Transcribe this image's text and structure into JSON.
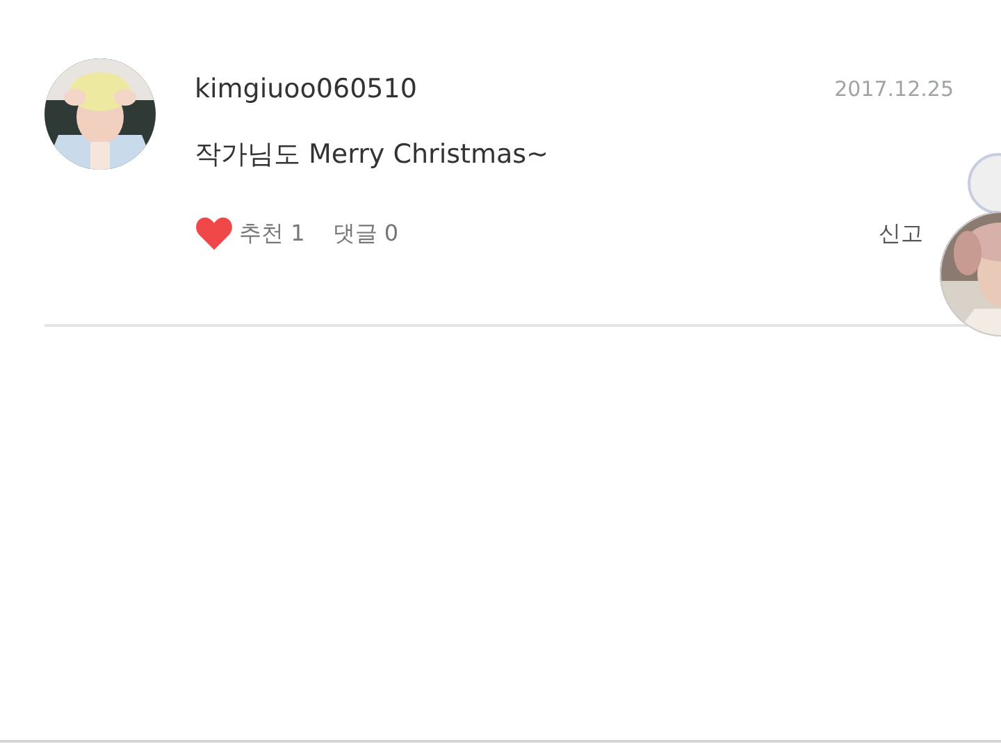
{
  "comment": {
    "username": "kimgiuoo060510",
    "date": "2017.12.25",
    "text": "작가님도 Merry Christmas~",
    "liked": true,
    "recommend": "추천 1",
    "replies": "댓글 0",
    "report": "신고"
  }
}
